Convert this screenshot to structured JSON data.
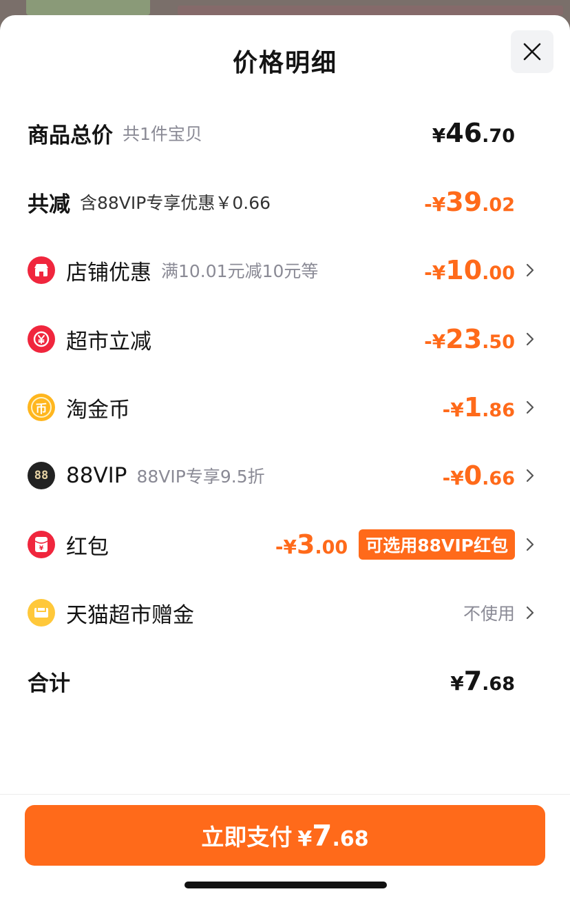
{
  "title": "价格明细",
  "rows": {
    "total": {
      "label": "商品总价",
      "sub": "共1件宝贝",
      "cur": "¥",
      "int": "46",
      "dec": ".70"
    },
    "reduce": {
      "label": "共减",
      "sub": "含88VIP专享优惠￥0.66",
      "cur": "-¥",
      "int": "39",
      "dec": ".02"
    },
    "shop": {
      "label": "店铺优惠",
      "sub": "满10.01元减10元等",
      "cur": "-¥",
      "int": "10",
      "dec": ".00",
      "icon": "shop-icon",
      "color": "#f0263d"
    },
    "market": {
      "label": "超市立减",
      "cur": "-¥",
      "int": "23",
      "dec": ".50",
      "icon": "yen-coin-icon",
      "color": "#f0263d"
    },
    "coin": {
      "label": "淘金币",
      "cur": "-¥",
      "int": "1",
      "dec": ".86",
      "icon": "gold-coin-icon",
      "color": "#ffb61e",
      "glyph": "币"
    },
    "vip": {
      "label": "88VIP",
      "sub": "88VIP专享9.5折",
      "cur": "-¥",
      "int": "0",
      "dec": ".66",
      "icon": "vip88-icon",
      "color": "#222222",
      "glyph": "88"
    },
    "redpack": {
      "label": "红包",
      "cur": "-¥",
      "int": "3",
      "dec": ".00",
      "badge": "可选用88VIP红包",
      "icon": "red-packet-icon",
      "color": "#f0263d"
    },
    "gift": {
      "label": "天猫超市赠金",
      "value": "不使用",
      "icon": "gift-card-icon",
      "color": "#ffc83a"
    },
    "sum": {
      "label": "合计",
      "cur": "¥",
      "int": "7",
      "dec": ".68"
    }
  },
  "pay": {
    "label": "立即支付",
    "cur": "¥",
    "int": "7",
    "dec": ".68"
  },
  "colors": {
    "accent": "#ff6a1a",
    "red": "#f0263d",
    "gold": "#ffb61e"
  }
}
